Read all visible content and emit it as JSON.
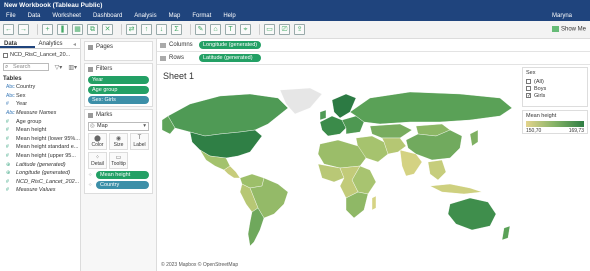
{
  "window": {
    "title": "New Workbook (Tableau Public)",
    "user": "Maryna"
  },
  "menu": [
    "File",
    "Data",
    "Worksheet",
    "Dashboard",
    "Analysis",
    "Map",
    "Format",
    "Help"
  ],
  "toolbar": {
    "show_me": "Show Me"
  },
  "data_pane": {
    "tabs": [
      "Data",
      "Analytics"
    ],
    "source": "NCD_RisC_Lancet_20...",
    "search_placeholder": "Search",
    "tables_header": "Tables",
    "fields": [
      {
        "type": "Abc",
        "name": "Country",
        "kind": "dim"
      },
      {
        "type": "Abc",
        "name": "Sex",
        "kind": "dim"
      },
      {
        "type": "#",
        "name": "Year",
        "kind": "dim"
      },
      {
        "type": "Abc",
        "name": "Measure Names",
        "kind": "dim-it"
      },
      {
        "type": "#",
        "name": "Age group",
        "kind": "measure"
      },
      {
        "type": "#",
        "name": "Mean height",
        "kind": "measure"
      },
      {
        "type": "#",
        "name": "Mean height (lower 95%...",
        "kind": "measure"
      },
      {
        "type": "#",
        "name": "Mean height standard e...",
        "kind": "measure"
      },
      {
        "type": "#",
        "name": "Mean height (upper 95...",
        "kind": "measure"
      },
      {
        "type": "⊕",
        "name": "Latitude (generated)",
        "kind": "measure-it"
      },
      {
        "type": "⊕",
        "name": "Longitude (generated)",
        "kind": "measure-it"
      },
      {
        "type": "#",
        "name": "NCD_RisC_Lancet_202...",
        "kind": "measure-it"
      },
      {
        "type": "#",
        "name": "Measure Values",
        "kind": "measure-it"
      }
    ]
  },
  "pages": {
    "title": "Pages"
  },
  "filters": {
    "title": "Filters",
    "pills": [
      "Year",
      "Age group",
      "Sex: Girls"
    ]
  },
  "marks": {
    "title": "Marks",
    "type": "Map",
    "buttons": [
      "Color",
      "Size",
      "Label",
      "Detail",
      "Tooltip"
    ],
    "pills": [
      {
        "label": "Mean height",
        "color": "green"
      },
      {
        "label": "Country",
        "color": "teal"
      }
    ]
  },
  "shelves": {
    "columns_label": "Columns",
    "columns_pill": "Longitude (generated)",
    "rows_label": "Rows",
    "rows_pill": "Latitude (generated)"
  },
  "sheet": {
    "title": "Sheet 1",
    "attribution": "© 2023 Mapbox  © OpenStreetMap"
  },
  "legend_sex": {
    "title": "Sex",
    "options": [
      {
        "label": "(All)",
        "checked": false
      },
      {
        "label": "Boys",
        "checked": false
      },
      {
        "label": "Girls",
        "checked": true
      }
    ]
  },
  "legend_height": {
    "title": "Mean height",
    "min": "150,70",
    "max": "169,73"
  },
  "colors": {
    "title_bar": "#1f447d",
    "pill_green": "#23a065",
    "pill_teal": "#3c8fa8"
  }
}
